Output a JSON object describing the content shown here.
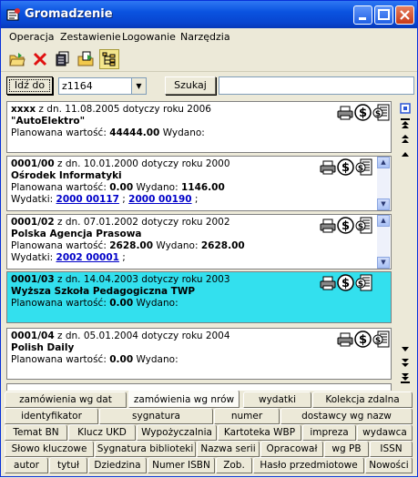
{
  "window": {
    "title": "Gromadzenie"
  },
  "menu": [
    "Operacja",
    "Zestawienie",
    "Logowanie",
    "Narzędzia"
  ],
  "search": {
    "goto_label": "Idź do",
    "combo_value": "z1164",
    "search_label": "Szukaj",
    "text_value": ""
  },
  "records": [
    {
      "id": "xxxx",
      "date_text": " z dn. 11.08.2005 dotyczy roku 2006",
      "name": "\"AutoElektro\"",
      "planned_label": "Planowana wartość: ",
      "planned_value": "44444.00",
      "spent_label": " Wydano:",
      "spent_value": ""
    },
    {
      "id": "0001/00",
      "date_text": " z dn. 10.01.2000 dotyczy roku 2000",
      "name": "Ośrodek Informatyki",
      "planned_label": "Planowana wartość: ",
      "planned_value": "0.00",
      "spent_label": " Wydano: ",
      "spent_value": "1146.00",
      "expenses_label": "Wydatki: ",
      "expenses": [
        "2000 00117",
        "2000 00190"
      ]
    },
    {
      "id": "0001/02",
      "date_text": " z dn. 07.01.2002 dotyczy roku 2002",
      "name": "Polska Agencja Prasowa",
      "planned_label": "Planowana wartość: ",
      "planned_value": "2628.00",
      "spent_label": " Wydano: ",
      "spent_value": "2628.00",
      "expenses_label": "Wydatki: ",
      "expenses": [
        "2002 00001"
      ]
    },
    {
      "id": "0001/03",
      "date_text": " z dn. 14.04.2003 dotyczy roku 2003",
      "name": "Wyższa Szkoła Pedagogiczna TWP",
      "planned_label": "Planowana wartość: ",
      "planned_value": "0.00",
      "spent_label": " Wydano:",
      "spent_value": ""
    },
    {
      "id": "0001/04",
      "date_text": " z dn. 05.01.2004 dotyczy roku 2004",
      "name": "Polish Daily",
      "planned_label": "Planowana wartość: ",
      "planned_value": "0.00",
      "spent_label": " Wydano:",
      "spent_value": ""
    }
  ],
  "tabs_rows": [
    [
      "zamówienia wg dat",
      "zamówienia wg nrów",
      "wydatki",
      "Kolekcja zdalna"
    ],
    [
      "identyfikator",
      "sygnatura",
      "numer",
      "dostawcy wg nazw"
    ],
    [
      "Temat BN",
      "Klucz UKD",
      "Wypożyczalnia",
      "Kartoteka WBP",
      "impreza",
      "wydawca"
    ],
    [
      "Słowo kluczowe",
      "Sygnatura biblioteki",
      "Nazwa serii",
      "Opracował",
      "wg PB",
      "ISSN"
    ],
    [
      "autor",
      "tytuł",
      "Dziedzina",
      "Numer ISBN",
      "Zob.",
      "Hasło przedmiotowe",
      "Nowości"
    ]
  ],
  "colors": {
    "selected_row": "#33e0ee",
    "title_bar": "#0a53e0",
    "link": "#0000c8"
  },
  "icons": [
    "print-icon",
    "dollar-icon",
    "document-dollar-icon"
  ]
}
